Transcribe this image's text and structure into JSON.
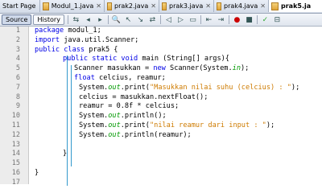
{
  "tabs": [
    {
      "label": "Start Page",
      "icon": "start-page-icon"
    },
    {
      "label": "Modul_1.java",
      "icon": "java-file-icon"
    },
    {
      "label": "prak2.java",
      "icon": "java-file-icon"
    },
    {
      "label": "prak3.java",
      "icon": "java-file-icon"
    },
    {
      "label": "prak4.java",
      "icon": "java-file-icon"
    },
    {
      "label": "prak5.ja",
      "icon": "java-file-icon"
    }
  ],
  "toolbar": {
    "source_label": "Source",
    "history_label": "History"
  },
  "line_numbers": [
    "1",
    "2",
    "3",
    "4",
    "5",
    "6",
    "7",
    "8",
    "9",
    "10",
    "11",
    "12",
    "13",
    "14",
    "15",
    "16",
    "17"
  ],
  "code": {
    "l1": "package modul_1;",
    "l2": "import java.util.Scanner;",
    "l3": "public class prak5 {",
    "l4": "public static void main (String[] args){",
    "l5": "Scanner masukkan = new Scanner(System.in);",
    "l6": "float celcius, reamur;",
    "l7_str": "\"Masukkan nilai suhu (celcius) : \"",
    "l8": "celcius = masukkan.nextFloat();",
    "l9": "reamur = 0.8f * celcius;",
    "l11_str": "\"nilai reamur dari input : \"",
    "l12_arg": "(reamur);",
    "l14": "}",
    "l16": "}"
  }
}
